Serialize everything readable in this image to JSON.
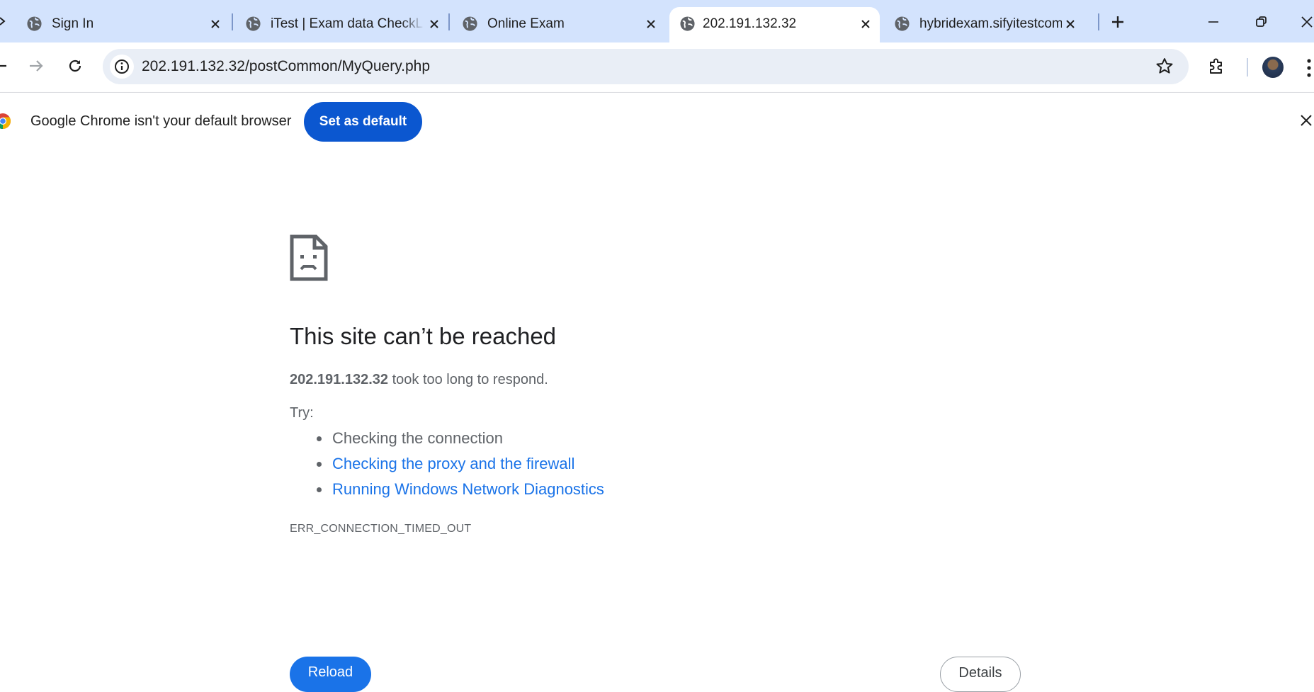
{
  "tabs": [
    {
      "title": "Sign In",
      "favicon": "globe-icon",
      "active": false
    },
    {
      "title": "iTest | Exam data CheckList",
      "favicon": "globe-icon",
      "active": false
    },
    {
      "title": "Online Exam",
      "favicon": "globe-icon",
      "active": false
    },
    {
      "title": "202.191.132.32",
      "favicon": "globe-icon",
      "active": true
    },
    {
      "title": "hybridexam.sifyitestcom",
      "favicon": "globe-icon",
      "active": false
    }
  ],
  "toolbar": {
    "url": "202.191.132.32/postCommon/MyQuery.php"
  },
  "infobar": {
    "message": "Google Chrome isn't your default browser",
    "button": "Set as default"
  },
  "error_page": {
    "heading": "This site can’t be reached",
    "host": "202.191.132.32",
    "summary_rest": " took too long to respond.",
    "try_label": "Try:",
    "suggestions": [
      {
        "text": "Checking the connection",
        "link": false
      },
      {
        "text": "Checking the proxy and the firewall",
        "link": true
      },
      {
        "text": "Running Windows Network Diagnostics",
        "link": true
      }
    ],
    "error_code": "ERR_CONNECTION_TIMED_OUT",
    "reload_button": "Reload",
    "details_button": "Details"
  },
  "colors": {
    "tab_strip_bg": "#d3e3fd",
    "omnibox_bg": "#e9eef6",
    "primary_button": "#0b57d0",
    "link": "#1a73e8"
  }
}
